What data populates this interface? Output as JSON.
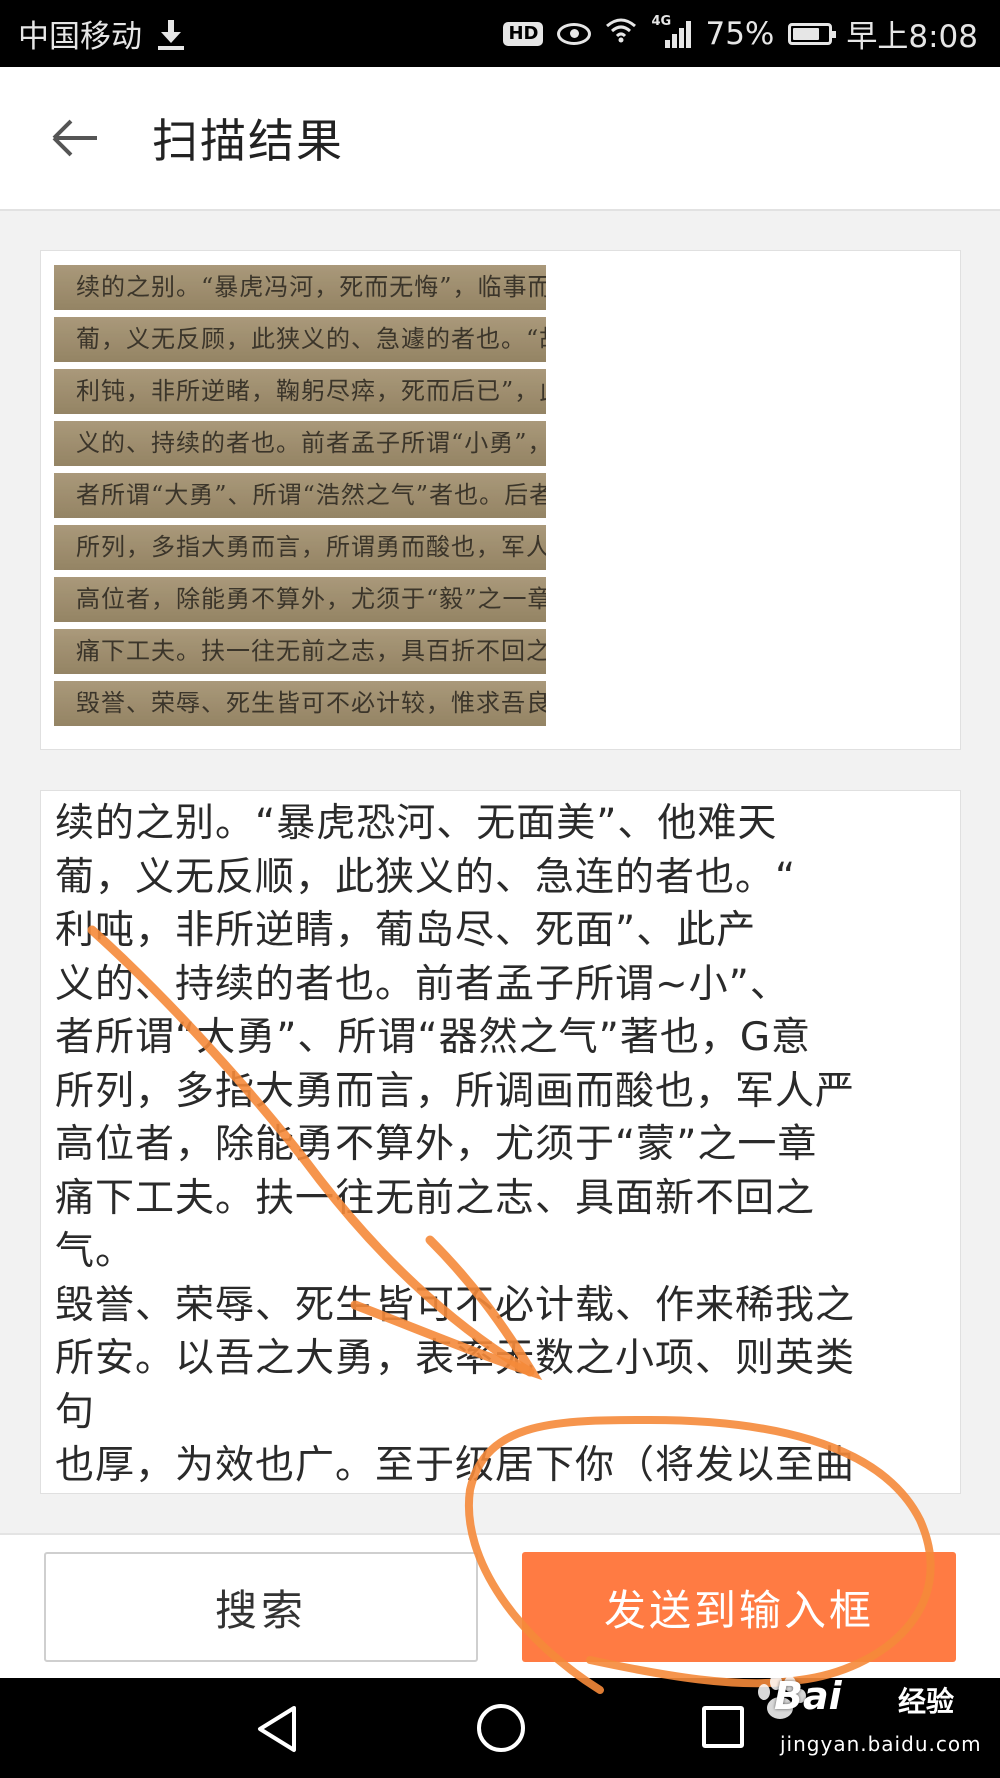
{
  "status_bar": {
    "carrier": "中国移动",
    "network": "4G",
    "battery": "75%",
    "battery_level": 0.75,
    "time": "早上8:08",
    "hd_badge": "HD",
    "icons": [
      "download-icon",
      "hd-icon",
      "eye-icon",
      "wifi-icon",
      "signal-icon",
      "battery-icon"
    ]
  },
  "app_bar": {
    "title": "扫描结果",
    "back_icon": "arrow-left-icon"
  },
  "scan_image": {
    "lines": [
      "续的之别。“暴虎冯河，死而无悔”，临事而",
      "葡，义无反顾，此狭义的、急遽的者也。“故",
      "利钝，非所逆睹，鞠躬尽瘁，死而后已”，此广",
      "义的、持续的者也。前者孟子所谓“小勇”，后",
      "者所谓“大勇”、所谓“浩然之气”者也。后者",
      "所列，多指大勇而言，所谓勇而酸也，军人之道",
      "高位者，除能勇不算外，尤须于“毅”之一章",
      "痛下工夫。扶一往无前之志，具百折不回之气",
      "毁誉、荣辱、死生皆可不必计较，惟求吾良知之",
      "所安。以吾之大勇，表率无数之小勇"
    ]
  },
  "result": {
    "text": "续的之别。“暴虎恐河、无面美”、他难天\n葡，义无反顺，此狭义的、急连的者也。“\n利吨，非所逆睛，葡岛尽、死面”、此产\n义的、持续的者也。前者孟子所谓~小”、\n者所谓“大勇”、所谓“器然之气”著也，G意\n所列，多指大勇而言，所调画而酸也，军人严\n高位者，除能勇不算外，尤须于“蒙”之一章\n痛下工夫。扶一往无前之志、具面新不回之\n气。\n毁誉、荣辱、死生皆可不必计载、作来稀我之\n所安。以吾之大勇，表率无数之小项、则英类\n句\n也厚，为效也广。至于级居下你（将发以至曲"
  },
  "actions": {
    "search_label": "搜索",
    "send_label": "发送到输入框",
    "send_color": "#ff7b43"
  },
  "nav_bar": {
    "icons": [
      "nav-back-icon",
      "nav-home-icon",
      "nav-recent-icon"
    ]
  },
  "annotation": {
    "color": "#f5893a"
  },
  "watermark": {
    "brand": "Bai",
    "suffix": "经验",
    "url": "jingyan.baidu.com"
  }
}
